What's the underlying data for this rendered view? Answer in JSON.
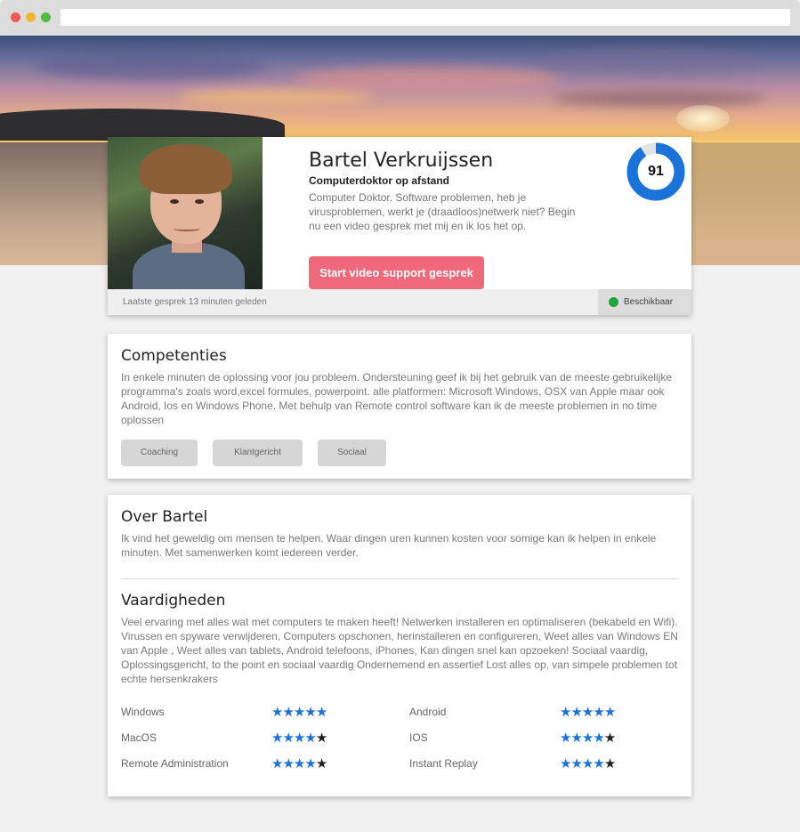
{
  "profile": {
    "name": "Bartel Verkruijssen",
    "tagline": "Computerdoktor op afstand",
    "intro": "Computer Doktor. Software problemen, heb je virusproblemen, werkt je (draadloos)netwerk niet? Begin nu een video gesprek met mij en ik los het op.",
    "cta_label": "Start video support gesprek",
    "score": "91",
    "score_fraction": 0.91,
    "last_call": "Laatste gesprek 13 minuten geleden",
    "availability": "Beschikbaar"
  },
  "competenties": {
    "title": "Competenties",
    "body": "In enkele minuten de oplossing voor jou probleem. Ondersteuning geef ik bij het gebruik van de meeste gebruikelijke programma's zoals word,excel formules, powerpoint. alle platformen: Microsoft Windows, OSX van Apple maar ook Android, Ios en Windows Phone. Met behulp van Remote control software kan ik de meeste problemen in no time oplossen",
    "tags": [
      "Coaching",
      "Klantgericht",
      "Sociaal"
    ]
  },
  "about": {
    "title": "Over Bartel",
    "body": "Ik vind het geweldig om mensen te helpen. Waar dingen uren kunnen kosten voor somige kan ik helpen in enkele minuten. Met samenwerken komt iedereen verder."
  },
  "vaardigheden": {
    "title": "Vaardigheden",
    "body": "Veel ervaring met alles wat met computers te maken heeft! Netwerken installeren en optimaliseren (bekabeld en Wifi). Virussen en spyware verwijderen, Computers opschonen, herinstalleren en configureren, Weet alles van Windows EN van Apple , Weet alles van tablets, Android telefoons, iPhones, Kan dingen snel kan opzoeken! Sociaal vaardig, Oplossingsgericht, to the point en sociaal vaardig Ondernemend en assertief Lost alles op, van simpele problemen tot echte hersenkrakers",
    "skills": [
      {
        "name": "Windows",
        "rating": 5
      },
      {
        "name": "Android",
        "rating": 5
      },
      {
        "name": "MacOS",
        "rating": 4
      },
      {
        "name": "IOS",
        "rating": 4
      },
      {
        "name": "Remote Administration",
        "rating": 4
      },
      {
        "name": "Instant Replay",
        "rating": 4
      }
    ],
    "max_rating": 5
  },
  "colors": {
    "cta": "#f0697a",
    "score_ring": "#1a73d8",
    "available": "#1fa53c",
    "star_on": "#1a73d8",
    "star_off": "#222222"
  }
}
